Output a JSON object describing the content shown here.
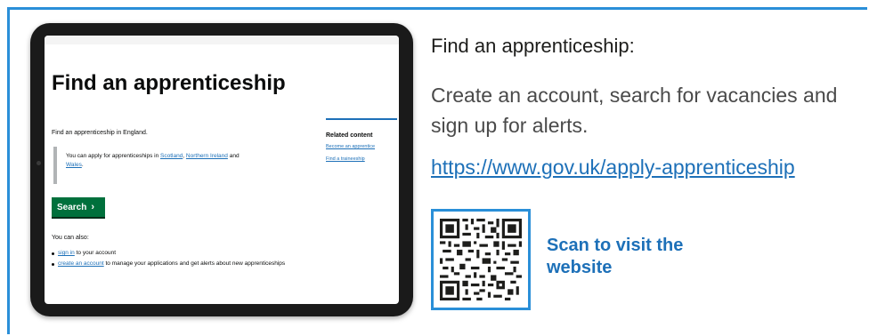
{
  "tablet_screen": {
    "title": "Find an apprenticeship",
    "subtitle": "Find an apprenticeship in England.",
    "inset": {
      "prefix": "You can apply for apprenticeships in ",
      "link1": "Scotland",
      "sep": ", ",
      "link2": "Northern Ireland",
      "and": " and ",
      "link3": "Wales",
      "suffix": "."
    },
    "search_button": "Search",
    "also_heading": "You can also:",
    "also_items": [
      {
        "link": "sign in",
        "text": " to your account"
      },
      {
        "link": "create an account",
        "text": " to manage your applications and get alerts about new apprenticeships"
      }
    ],
    "related": {
      "heading": "Related content",
      "links": [
        "Become an apprentice",
        "Find a traineeship"
      ]
    }
  },
  "info": {
    "heading": "Find an apprenticeship:",
    "description": "Create an account, search for vacancies and sign up for alerts.",
    "url": "https://www.gov.uk/apply-apprenticeship",
    "qr_label": "Scan to visit the website"
  },
  "colors": {
    "frame": "#2a8fd8",
    "link": "#1d70b8",
    "gov_green": "#00703c",
    "tablet_body": "#1a1a1a"
  },
  "icons": {
    "qr": "qr-code-icon",
    "chevron": "chevron-right-icon"
  }
}
